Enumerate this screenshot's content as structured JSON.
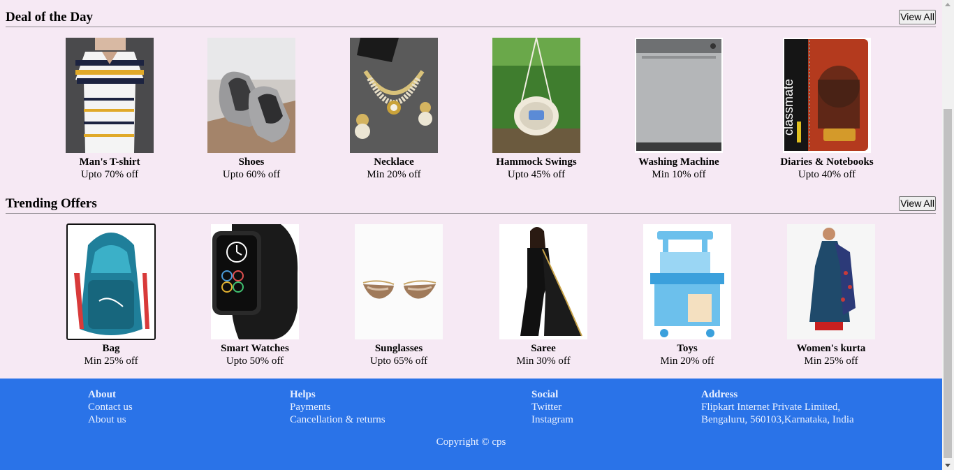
{
  "deals": {
    "title": "Deal of the Day",
    "view_all": "View All",
    "items": [
      {
        "name": "Man's T-shirt",
        "offer": "Upto 70% off",
        "image": "striped-tshirt"
      },
      {
        "name": "Shoes",
        "offer": "Upto 60% off",
        "image": "slip-on-shoes"
      },
      {
        "name": "Necklace",
        "offer": "Min 20% off",
        "image": "necklace-set"
      },
      {
        "name": "Hammock Swings",
        "offer": "Upto 45% off",
        "image": "hammock-swing"
      },
      {
        "name": "Washing Machine",
        "offer": "Min 10% off",
        "image": "washing-machine"
      },
      {
        "name": "Diaries & Notebooks",
        "offer": "Upto 40% off",
        "image": "notebook"
      }
    ]
  },
  "trending": {
    "title": "Trending Offers",
    "view_all": "View All",
    "items": [
      {
        "name": "Bag",
        "offer": "Min 25% off",
        "image": "backpack"
      },
      {
        "name": "Smart Watches",
        "offer": "Upto 50% off",
        "image": "smart-watch"
      },
      {
        "name": "Sunglasses",
        "offer": "Upto 65% off",
        "image": "sunglasses"
      },
      {
        "name": "Saree",
        "offer": "Min 30% off",
        "image": "saree"
      },
      {
        "name": "Toys",
        "offer": "Min 20% off",
        "image": "kitchen-toy"
      },
      {
        "name": "Women's kurta",
        "offer": "Min 25% off",
        "image": "kurta"
      }
    ]
  },
  "footer": {
    "about": {
      "heading": "About",
      "links": [
        "Contact us",
        "About us"
      ]
    },
    "helps": {
      "heading": "Helps",
      "links": [
        "Payments",
        "Cancellation & returns"
      ]
    },
    "social": {
      "heading": "Social",
      "links": [
        "Twitter",
        "Instagram"
      ]
    },
    "address": {
      "heading": "Address",
      "lines": [
        "Flipkart Internet Private Limited,",
        "Bengaluru, 560103,Karnataka, India"
      ]
    },
    "copyright": "Copyright © cps"
  },
  "notebook_brand": "classmate",
  "colors": {
    "page_bg": "#f6e9f4",
    "footer_bg": "#2a73e8",
    "footer_text": "#e9f0ff"
  }
}
